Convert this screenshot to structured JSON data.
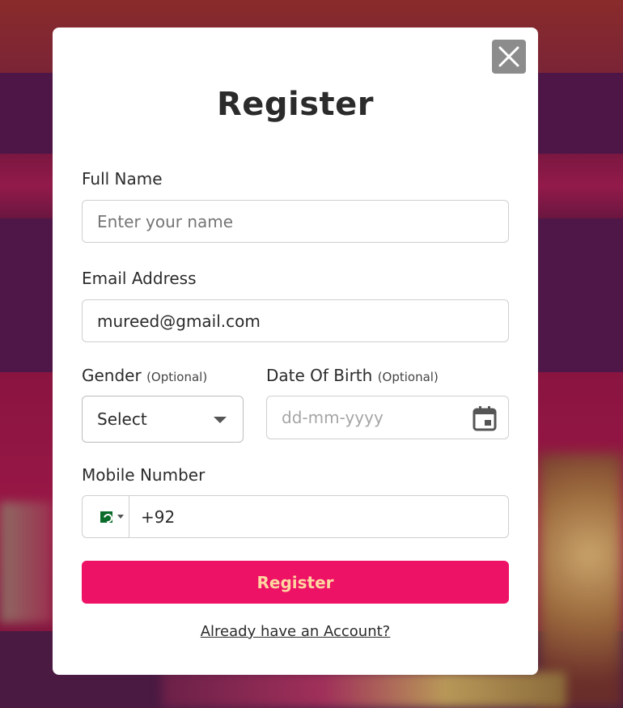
{
  "modal": {
    "title": "Register",
    "close_icon": "close-icon"
  },
  "form": {
    "full_name": {
      "label": "Full Name",
      "placeholder": "Enter your name",
      "value": ""
    },
    "email": {
      "label": "Email Address",
      "value": "mureed@gmail.com"
    },
    "gender": {
      "label": "Gender",
      "optional": "(Optional)",
      "selected": "Select"
    },
    "dob": {
      "label": "Date Of Birth",
      "optional": "(Optional)",
      "placeholder": "dd-mm-yyyy",
      "icon": "calendar-icon"
    },
    "mobile": {
      "label": "Mobile Number",
      "country_flag": "pakistan-flag-icon",
      "value": "+92"
    },
    "submit_label": "Register",
    "login_link": "Already have an Account?"
  },
  "colors": {
    "accent": "#ee1266",
    "button_text": "#ffd6a0",
    "close_bg": "#8c8c8c"
  }
}
